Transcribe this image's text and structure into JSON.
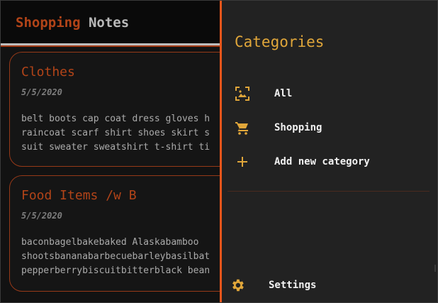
{
  "app": {
    "title_part1": "Shopping",
    "title_part2": "Notes"
  },
  "notes": [
    {
      "title": "Clothes",
      "date": "5/5/2020",
      "body_lines": [
        "belt boots cap coat dress gloves h",
        "raincoat scarf shirt shoes skirt s",
        "suit sweater sweatshirt t-shirt ti"
      ]
    },
    {
      "title": "Food Items /w B",
      "date": "5/5/2020",
      "body_lines": [
        "baconbagelbakebaked Alaskabamboo",
        "shootsbananabarbecuebarleybasilbat",
        "pepperberrybiscuitbitterblack bean"
      ]
    }
  ],
  "drawer": {
    "title": "Categories",
    "items": [
      {
        "label": "All",
        "icon": "image-frame-icon"
      },
      {
        "label": "Shopping",
        "icon": "shopping-cart-icon"
      },
      {
        "label": "Add new category",
        "icon": "plus-icon"
      }
    ],
    "settings_label": "Settings",
    "settings_icon": "gear-icon",
    "accent_color": "#e0a63a",
    "border_color": "#e8561b"
  }
}
